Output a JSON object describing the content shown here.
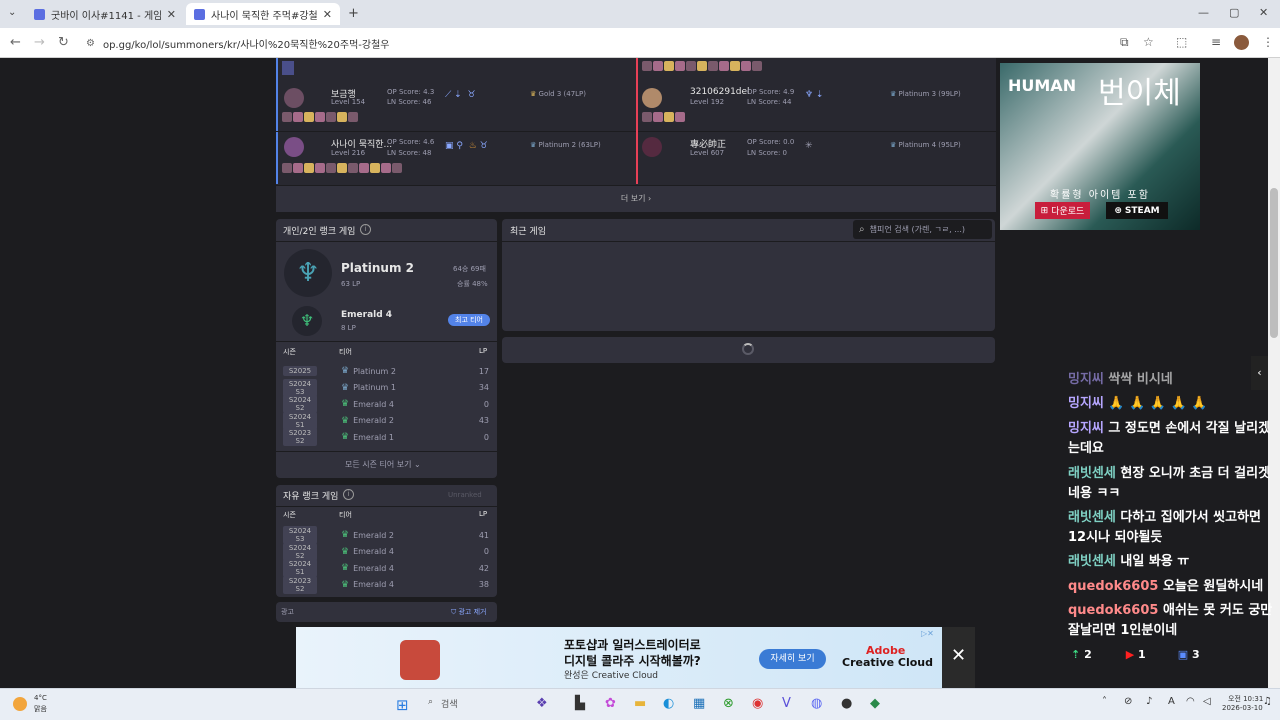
{
  "browser": {
    "tabs": [
      {
        "title": "굿바이 이사#1141 - 게임 전적"
      },
      {
        "title": "사나이 묵직한 주먹#강철우 - 게임"
      }
    ],
    "new_tab": "+",
    "url": "op.gg/ko/lol/summoners/kr/사나이%20묵직한%20주먹-강철우"
  },
  "players": [
    {
      "name": "보금행",
      "level": "Level 154",
      "op": "OP Score: 4.3",
      "ln": "LN Score: 46",
      "tier": "Gold 3 (47LP)"
    },
    {
      "name": "사나이 묵직한...",
      "level": "Level 216",
      "op": "OP Score: 4.6",
      "ln": "LN Score: 48",
      "tier": "Platinum 2 (63LP)"
    },
    {
      "name": "32106291del",
      "level": "Level 192",
      "op": "OP Score: 4.9",
      "ln": "LN Score: 44",
      "tier": "Platinum 3 (99LP)"
    },
    {
      "name": "專必帥正",
      "level": "Level 607",
      "op": "OP Score: 0.0",
      "ln": "LN Score: 0",
      "tier": "Platinum 4 (95LP)"
    }
  ],
  "more": "더 보기",
  "solo": {
    "title": "개인/2인 랭크 게임",
    "tier": "Platinum 2",
    "lp": "63 LP",
    "record": "64승 69패",
    "winrate": "승률 48%",
    "peak_tier": "Emerald 4",
    "peak_lp": "8 LP",
    "peak_badge": "최고 티어",
    "headers": [
      "시즌",
      "티어",
      "LP"
    ],
    "rows": [
      {
        "season": "S2025",
        "tier": "Platinum 2",
        "lp": "17"
      },
      {
        "season": "S2024 S3",
        "tier": "Platinum 1",
        "lp": "34"
      },
      {
        "season": "S2024 S2",
        "tier": "Emerald 4",
        "lp": "0"
      },
      {
        "season": "S2024 S1",
        "tier": "Emerald 2",
        "lp": "43"
      },
      {
        "season": "S2023 S2",
        "tier": "Emerald 1",
        "lp": "0"
      }
    ],
    "all_seasons": "모든 시즌 티어 보기"
  },
  "flex": {
    "title": "자유 랭크 게임",
    "status": "Unranked",
    "headers": [
      "시즌",
      "티어",
      "LP"
    ],
    "rows": [
      {
        "season": "S2024 S3",
        "tier": "Emerald 2",
        "lp": "41"
      },
      {
        "season": "S2024 S2",
        "tier": "Emerald 4",
        "lp": "0"
      },
      {
        "season": "S2024 S1",
        "tier": "Emerald 4",
        "lp": "42"
      },
      {
        "season": "S2023 S2",
        "tier": "Emerald 4",
        "lp": "38"
      }
    ]
  },
  "ad_label": "광고",
  "ad_remove": "광고 제거",
  "recent": {
    "title": "최근 게임",
    "search_placeholder": "챔피언 검색 (가렌, ㄱㄹ, ...)"
  },
  "banner": {
    "text1": "포토샵과 일러스트레이터로",
    "text2": "디지털 콜라주 시작해볼까?",
    "sub": "완성은 Creative Cloud",
    "cta": "자세히 보기",
    "brand": "Adobe",
    "brand2": "Creative Cloud"
  },
  "side_ad": {
    "title": "HUMAN",
    "korean": "번이체",
    "caption": "확률형 아이템 포함",
    "download": "다운로드",
    "steam": "STEAM"
  },
  "chat": [
    {
      "name": "밍지씨",
      "msg": "싹싹 비시네"
    },
    {
      "name": "밍지씨",
      "msg": "🙏 🙏 🙏 🙏 🙏"
    },
    {
      "name": "밍지씨",
      "msg": "그 정도면 손에서 각질 날리겠는데요"
    },
    {
      "name": "래빗센세",
      "msg": "현장 오니까 초금 더 걸리겟네용 ㅋㅋ"
    },
    {
      "name": "래빗센세",
      "msg": "다하고 집에가서 씻고하면 12시나 되야될듯"
    },
    {
      "name": "래빗센세",
      "msg": "내일 봐용 ㅠ"
    },
    {
      "name": "quedok6605",
      "msg": "오늘은 원딜하시네"
    },
    {
      "name": "quedok6605",
      "msg": "애쉬는 못 커도 궁만 잘날리면 1인분이네"
    }
  ],
  "chat_counts": [
    "2",
    "1",
    "3"
  ],
  "taskbar": {
    "weather_temp": "4°C",
    "weather_desc": "맑음",
    "search": "검색",
    "time": "오전 10:31",
    "date": "2026-03-10"
  }
}
